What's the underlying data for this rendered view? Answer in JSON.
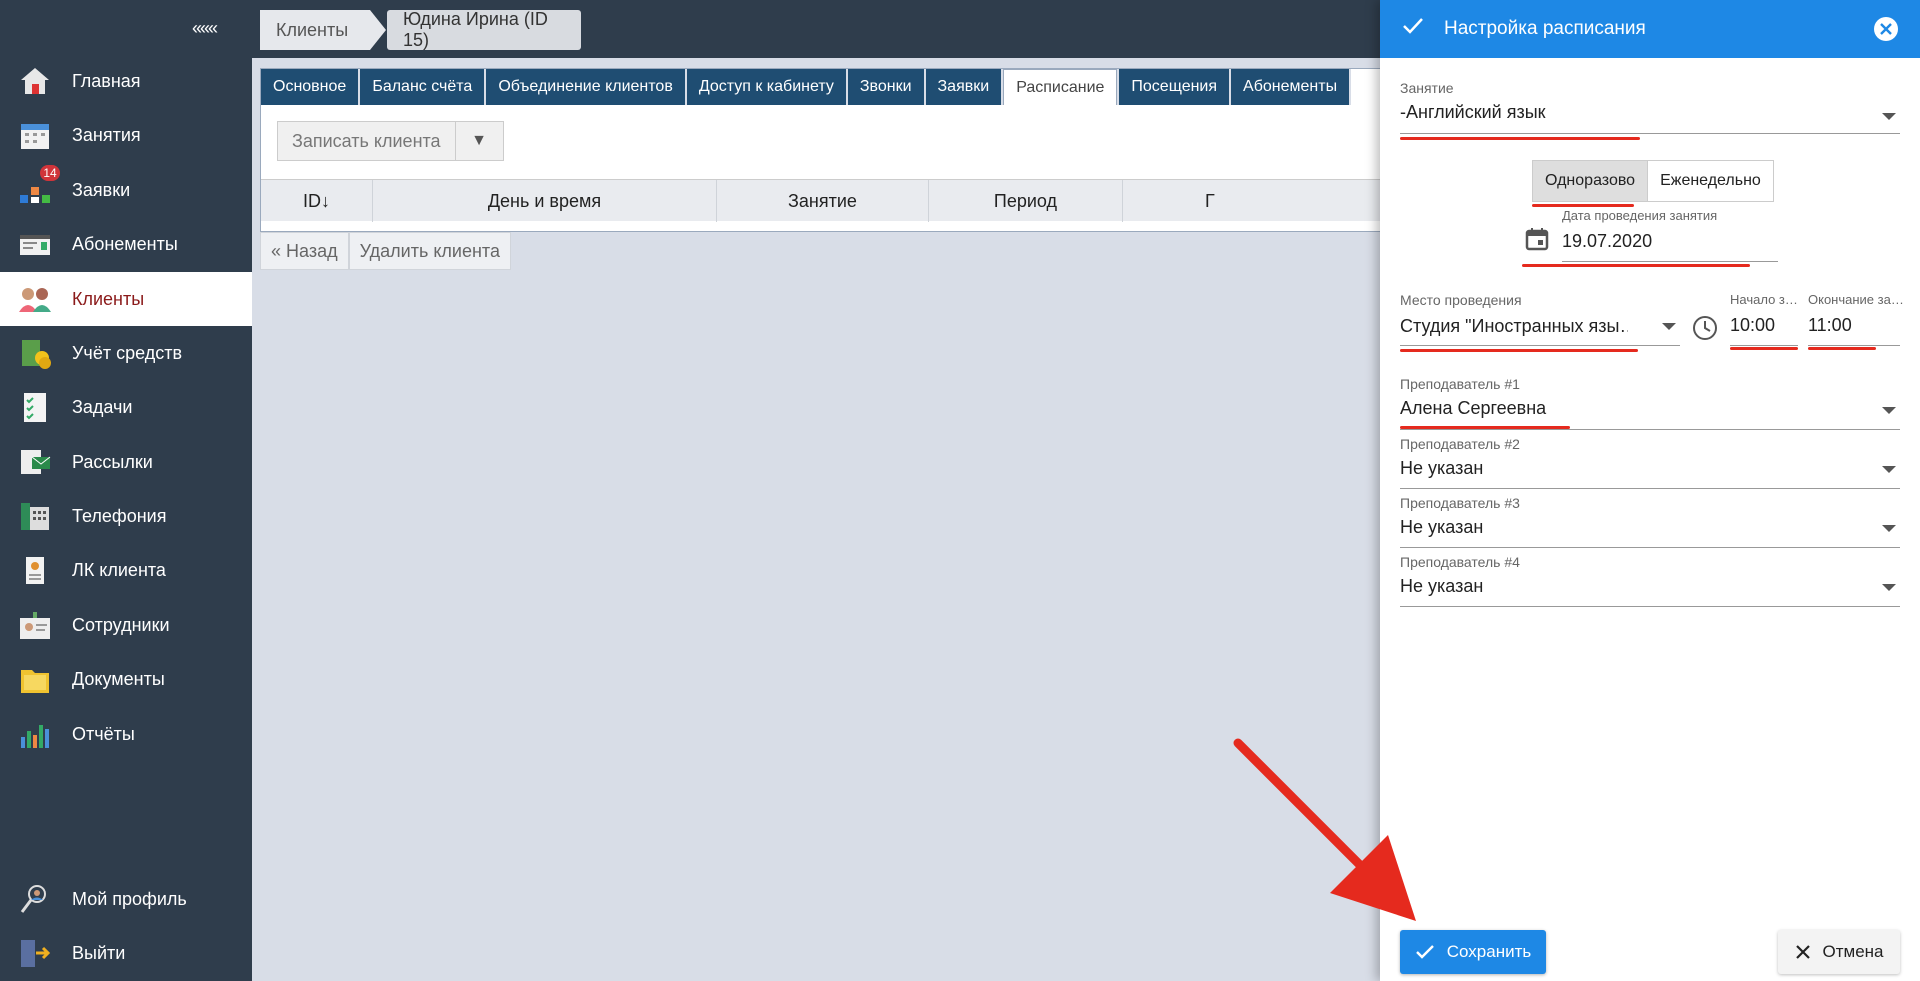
{
  "sidebar": {
    "collapse_label": "«««",
    "items": [
      {
        "label": "Главная",
        "icon": "home-icon"
      },
      {
        "label": "Занятия",
        "icon": "calendar-icon"
      },
      {
        "label": "Заявки",
        "icon": "requests-icon",
        "badge": "14"
      },
      {
        "label": "Абонементы",
        "icon": "subscription-card-icon"
      },
      {
        "label": "Клиенты",
        "icon": "clients-icon",
        "active": true
      },
      {
        "label": "Учёт средств",
        "icon": "money-icon"
      },
      {
        "label": "Задачи",
        "icon": "checklist-icon"
      },
      {
        "label": "Рассылки",
        "icon": "mailing-icon"
      },
      {
        "label": "Телефония",
        "icon": "phone-icon"
      },
      {
        "label": "ЛК клиента",
        "icon": "client-badge-icon"
      },
      {
        "label": "Сотрудники",
        "icon": "staff-icon"
      },
      {
        "label": "Документы",
        "icon": "documents-icon"
      },
      {
        "label": "Отчёты",
        "icon": "reports-chart-icon"
      }
    ],
    "bottom_items": [
      {
        "label": "Мой профиль",
        "icon": "profile-icon"
      },
      {
        "label": "Выйти",
        "icon": "logout-icon"
      }
    ]
  },
  "breadcrumbs": [
    "Клиенты",
    "Юдина Ирина (ID 15)"
  ],
  "tabs": [
    "Основное",
    "Баланс счёта",
    "Объединение клиентов",
    "Доступ к кабинету",
    "Звонки",
    "Заявки",
    "Расписание",
    "Посещения",
    "Абонементы"
  ],
  "active_tab": "Расписание",
  "toolbar": {
    "enroll_label": "Записать клиента",
    "dropdown_glyph": "▼"
  },
  "grid_columns": [
    "ID↓",
    "День и время",
    "Занятие",
    "Период",
    "Г"
  ],
  "bottom_buttons": {
    "back_label": "« Назад",
    "delete_label": "Удалить клиента"
  },
  "drawer": {
    "title": "Настройка расписания",
    "lesson": {
      "label": "Занятие",
      "value": "-Английский язык"
    },
    "frequency": {
      "options": [
        "Одноразово",
        "Еженедельно"
      ],
      "selected": "Одноразово"
    },
    "date": {
      "label": "Дата проведения занятия",
      "value": "19.07.2020"
    },
    "place": {
      "label": "Место проведения",
      "value": "Студия \"Иностранных язы…"
    },
    "start": {
      "label": "Начало з…",
      "value": "10:00"
    },
    "end": {
      "label": "Окончание за…",
      "value": "11:00"
    },
    "teachers": [
      {
        "label": "Преподаватель #1",
        "value": "Алена Сергеевна"
      },
      {
        "label": "Преподаватель #2",
        "value": "Не указан"
      },
      {
        "label": "Преподаватель #3",
        "value": "Не указан"
      },
      {
        "label": "Преподаватель #4",
        "value": "Не указан"
      }
    ],
    "save_label": "Сохранить",
    "cancel_label": "Отмена"
  },
  "colors": {
    "accent": "#1e88e5",
    "sidebar": "#2f3d4c",
    "tab": "#1f4d72",
    "annotation": "#e52a1e"
  }
}
